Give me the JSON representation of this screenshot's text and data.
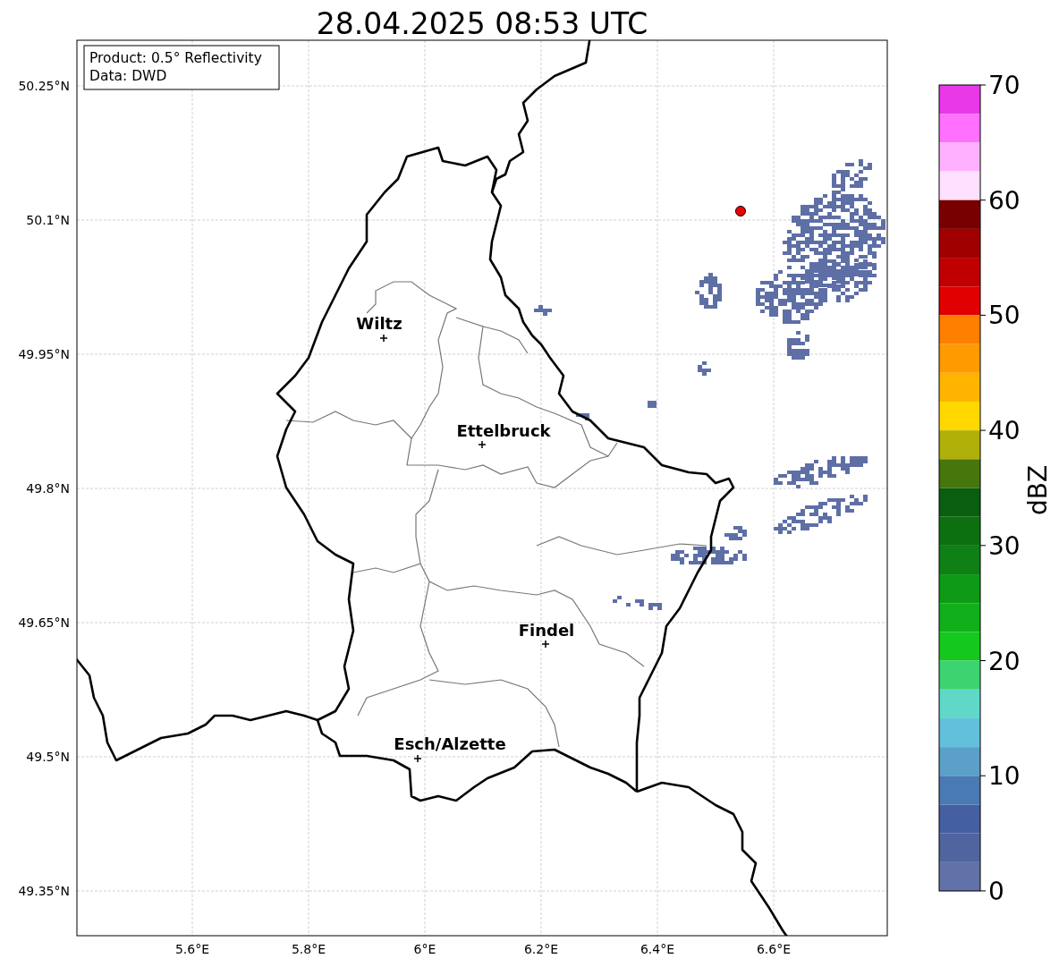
{
  "title": "28.04.2025 08:53 UTC",
  "info": [
    "Product: 0.5° Reflectivity",
    "Data: DWD"
  ],
  "map": {
    "lat_ticks": [
      "50.25°N",
      "50.1°N",
      "49.95°N",
      "49.8°N",
      "49.65°N",
      "49.5°N",
      "49.35°N"
    ],
    "lon_ticks": [
      "5.6°E",
      "5.8°E",
      "6°E",
      "6.2°E",
      "6.4°E",
      "6.6°E"
    ],
    "cities": [
      "Wiltz",
      "Ettelbruck",
      "Findel",
      "Esch/Alzette"
    ]
  },
  "colorbar": {
    "ticks": [
      "70",
      "60",
      "50",
      "40",
      "30",
      "20",
      "10",
      "0"
    ],
    "bins": [
      {
        "color": "#e838e8"
      },
      {
        "color": "#ff70ff"
      },
      {
        "color": "#ffb0ff"
      },
      {
        "color": "#ffe0ff"
      },
      {
        "color": "#780000"
      },
      {
        "color": "#a00000"
      },
      {
        "color": "#c00000"
      },
      {
        "color": "#e00000"
      },
      {
        "color": "#ff7f00"
      },
      {
        "color": "#ff9a00"
      },
      {
        "color": "#ffb400"
      },
      {
        "color": "#ffd800"
      },
      {
        "color": "#b0b00a"
      },
      {
        "color": "#46760c"
      },
      {
        "color": "#0a5e10"
      },
      {
        "color": "#0c7010"
      },
      {
        "color": "#0e8016"
      },
      {
        "color": "#0e9a16"
      },
      {
        "color": "#10b01a"
      },
      {
        "color": "#14c81e"
      },
      {
        "color": "#3cd470"
      },
      {
        "color": "#60d8c8"
      },
      {
        "color": "#62c0dc"
      },
      {
        "color": "#5aa0c8"
      },
      {
        "color": "#4a7ab4"
      },
      {
        "color": "#4460a2"
      },
      {
        "color": "#5064a0"
      },
      {
        "color": "#6272a8"
      }
    ],
    "label": "dBZ"
  }
}
